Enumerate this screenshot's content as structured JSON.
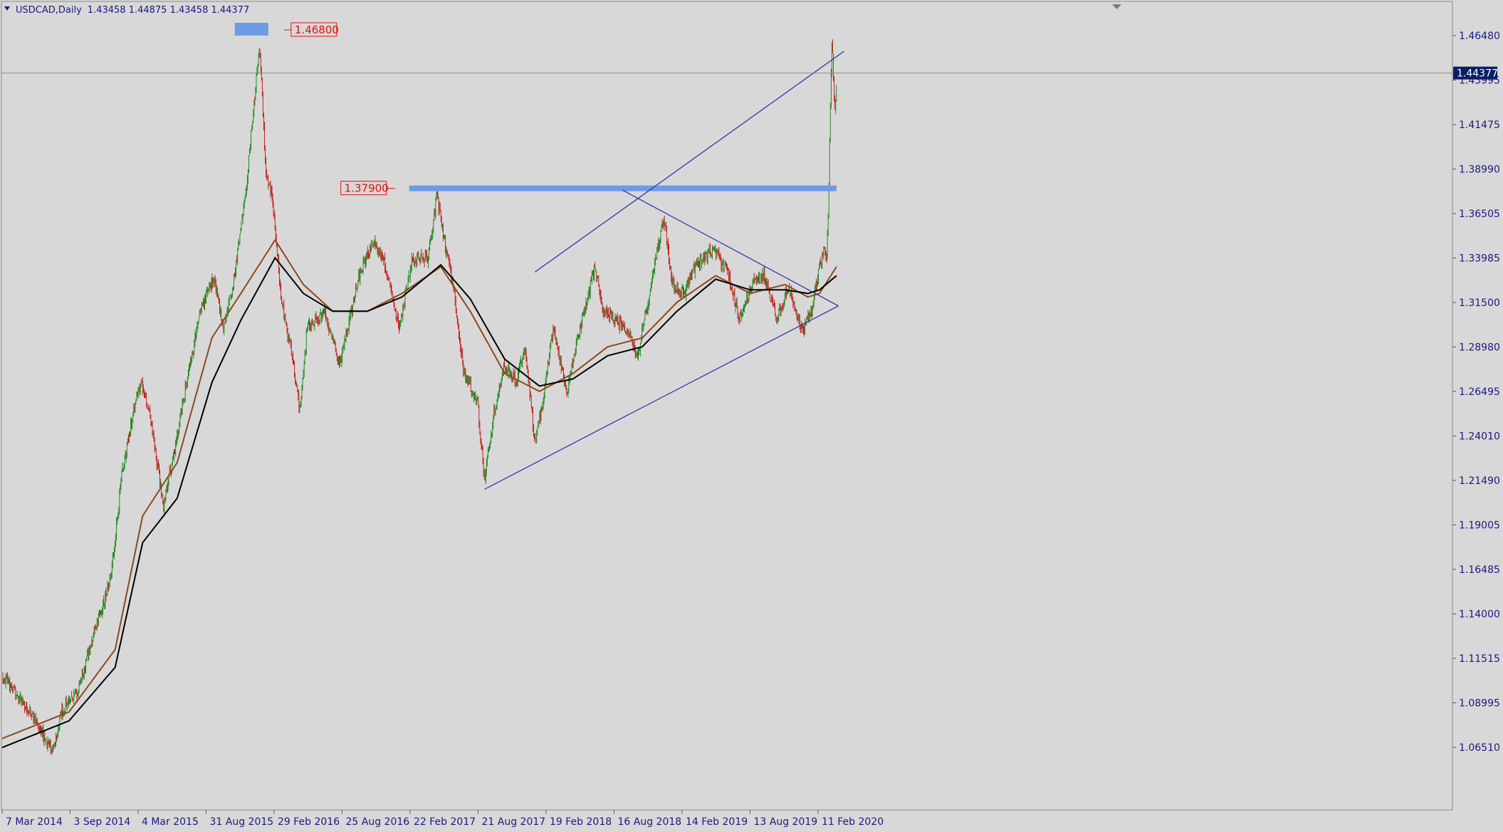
{
  "header": {
    "symbol": "USDCAD,Daily",
    "ohlc": "1.43458 1.44875 1.43458 1.44377"
  },
  "price_label": "1.44377",
  "annotations": {
    "high_label": "1.46800",
    "resistance_label": "1.37900"
  },
  "colors": {
    "background": "#d8d8d8",
    "axis_text": "#1a1a80",
    "bull": "#1f8a1f",
    "bear": "#c81e1e",
    "ma_fast": "#8b4a1c",
    "ma_slow": "#000000",
    "zone": "#6e9be6",
    "trendline": "#2a2aa8",
    "current_price_bg": "#0a1e66",
    "annotation_red": "#e01010"
  },
  "chart_data": {
    "type": "candlestick",
    "symbol": "USDCAD",
    "timeframe": "Daily",
    "ylim": [
      1.055,
      1.475
    ],
    "y_ticks": [
      "1.46480",
      "1.43995",
      "1.41475",
      "1.38990",
      "1.36505",
      "1.33985",
      "1.31500",
      "1.28980",
      "1.26495",
      "1.24010",
      "1.21490",
      "1.19005",
      "1.16485",
      "1.14000",
      "1.11515",
      "1.08995",
      "1.06510"
    ],
    "x_ticks": [
      "7 Mar 2014",
      "3 Sep 2014",
      "4 Mar 2015",
      "31 Aug 2015",
      "29 Feb 2016",
      "25 Aug 2016",
      "22 Feb 2017",
      "21 Aug 2017",
      "19 Feb 2018",
      "16 Aug 2018",
      "14 Feb 2019",
      "13 Aug 2019",
      "11 Feb 2020"
    ],
    "price_path": [
      [
        "2014-03-07",
        1.105
      ],
      [
        "2014-04-15",
        1.095
      ],
      [
        "2014-06-01",
        1.08
      ],
      [
        "2014-07-01",
        1.07
      ],
      [
        "2014-07-20",
        1.062
      ],
      [
        "2014-08-10",
        1.085
      ],
      [
        "2014-09-20",
        1.095
      ],
      [
        "2014-11-01",
        1.125
      ],
      [
        "2014-12-20",
        1.16
      ],
      [
        "2015-01-20",
        1.22
      ],
      [
        "2015-02-15",
        1.25
      ],
      [
        "2015-03-10",
        1.27
      ],
      [
        "2015-04-05",
        1.25
      ],
      [
        "2015-05-10",
        1.2
      ],
      [
        "2015-06-10",
        1.235
      ],
      [
        "2015-07-10",
        1.27
      ],
      [
        "2015-08-15",
        1.31
      ],
      [
        "2015-09-20",
        1.33
      ],
      [
        "2015-10-15",
        1.3
      ],
      [
        "2015-11-15",
        1.33
      ],
      [
        "2015-12-20",
        1.39
      ],
      [
        "2016-01-20",
        1.46
      ],
      [
        "2016-02-05",
        1.39
      ],
      [
        "2016-02-25",
        1.37
      ],
      [
        "2016-03-15",
        1.32
      ],
      [
        "2016-04-10",
        1.29
      ],
      [
        "2016-05-05",
        1.255
      ],
      [
        "2016-05-25",
        1.3
      ],
      [
        "2016-07-10",
        1.31
      ],
      [
        "2016-08-20",
        1.28
      ],
      [
        "2016-10-10",
        1.33
      ],
      [
        "2016-11-15",
        1.35
      ],
      [
        "2016-12-20",
        1.335
      ],
      [
        "2017-01-25",
        1.3
      ],
      [
        "2017-03-01",
        1.34
      ],
      [
        "2017-04-10",
        1.34
      ],
      [
        "2017-05-05",
        1.375
      ],
      [
        "2017-05-20",
        1.355
      ],
      [
        "2017-06-20",
        1.32
      ],
      [
        "2017-07-15",
        1.275
      ],
      [
        "2017-08-20",
        1.26
      ],
      [
        "2017-09-08",
        1.215
      ],
      [
        "2017-10-05",
        1.255
      ],
      [
        "2017-11-01",
        1.28
      ],
      [
        "2017-12-01",
        1.27
      ],
      [
        "2017-12-25",
        1.29
      ],
      [
        "2018-01-20",
        1.235
      ],
      [
        "2018-02-10",
        1.26
      ],
      [
        "2018-03-10",
        1.3
      ],
      [
        "2018-04-15",
        1.265
      ],
      [
        "2018-05-20",
        1.3
      ],
      [
        "2018-06-28",
        1.335
      ],
      [
        "2018-07-20",
        1.31
      ],
      [
        "2018-08-20",
        1.305
      ],
      [
        "2018-09-20",
        1.3
      ],
      [
        "2018-10-20",
        1.285
      ],
      [
        "2018-11-20",
        1.32
      ],
      [
        "2018-12-28",
        1.363
      ],
      [
        "2019-01-20",
        1.325
      ],
      [
        "2019-02-20",
        1.32
      ],
      [
        "2019-03-20",
        1.335
      ],
      [
        "2019-05-10",
        1.345
      ],
      [
        "2019-06-20",
        1.33
      ],
      [
        "2019-07-15",
        1.305
      ],
      [
        "2019-08-20",
        1.325
      ],
      [
        "2019-09-20",
        1.33
      ],
      [
        "2019-10-25",
        1.305
      ],
      [
        "2019-11-25",
        1.325
      ],
      [
        "2019-12-31",
        1.298
      ],
      [
        "2020-01-25",
        1.31
      ],
      [
        "2020-02-10",
        1.33
      ],
      [
        "2020-02-28",
        1.345
      ],
      [
        "2020-03-05",
        1.34
      ],
      [
        "2020-03-10",
        1.375
      ],
      [
        "2020-03-19",
        1.465
      ],
      [
        "2020-03-26",
        1.42
      ],
      [
        "2020-03-31",
        1.44
      ]
    ],
    "moving_averages": [
      {
        "color_key": "ma_fast",
        "path": [
          [
            "2014-03-07",
            1.07
          ],
          [
            "2014-09-01",
            1.085
          ],
          [
            "2015-01-01",
            1.12
          ],
          [
            "2015-03-15",
            1.195
          ],
          [
            "2015-06-15",
            1.225
          ],
          [
            "2015-09-15",
            1.295
          ],
          [
            "2015-12-01",
            1.32
          ],
          [
            "2016-03-01",
            1.35
          ],
          [
            "2016-05-15",
            1.325
          ],
          [
            "2016-08-01",
            1.31
          ],
          [
            "2016-11-01",
            1.31
          ],
          [
            "2017-02-01",
            1.32
          ],
          [
            "2017-05-15",
            1.335
          ],
          [
            "2017-08-01",
            1.31
          ],
          [
            "2017-11-01",
            1.275
          ],
          [
            "2018-02-01",
            1.265
          ],
          [
            "2018-05-01",
            1.275
          ],
          [
            "2018-08-01",
            1.29
          ],
          [
            "2018-11-01",
            1.295
          ],
          [
            "2019-02-01",
            1.315
          ],
          [
            "2019-05-15",
            1.33
          ],
          [
            "2019-08-15",
            1.32
          ],
          [
            "2019-11-15",
            1.325
          ],
          [
            "2020-01-15",
            1.318
          ],
          [
            "2020-02-15",
            1.32
          ],
          [
            "2020-03-31",
            1.335
          ]
        ]
      },
      {
        "color_key": "ma_slow",
        "path": [
          [
            "2014-03-07",
            1.065
          ],
          [
            "2014-09-01",
            1.08
          ],
          [
            "2015-01-01",
            1.11
          ],
          [
            "2015-03-15",
            1.18
          ],
          [
            "2015-06-15",
            1.205
          ],
          [
            "2015-09-15",
            1.27
          ],
          [
            "2015-12-01",
            1.305
          ],
          [
            "2016-03-01",
            1.34
          ],
          [
            "2016-05-15",
            1.32
          ],
          [
            "2016-08-01",
            1.31
          ],
          [
            "2016-11-01",
            1.31
          ],
          [
            "2017-02-01",
            1.318
          ],
          [
            "2017-05-15",
            1.336
          ],
          [
            "2017-08-01",
            1.317
          ],
          [
            "2017-11-01",
            1.283
          ],
          [
            "2018-02-01",
            1.268
          ],
          [
            "2018-05-01",
            1.272
          ],
          [
            "2018-08-01",
            1.285
          ],
          [
            "2018-11-01",
            1.29
          ],
          [
            "2019-02-01",
            1.31
          ],
          [
            "2019-05-15",
            1.328
          ],
          [
            "2019-08-15",
            1.322
          ],
          [
            "2019-11-15",
            1.322
          ],
          [
            "2020-01-15",
            1.32
          ],
          [
            "2020-02-15",
            1.322
          ],
          [
            "2020-03-31",
            1.33
          ]
        ]
      }
    ],
    "current_price": 1.44377,
    "zones": [
      {
        "label_key": "high_label",
        "price": 1.468,
        "from": "2015-11-15",
        "to": "2016-02-12",
        "kind": "marker"
      },
      {
        "label_key": "resistance_label",
        "price": 1.379,
        "from": "2017-02-20",
        "to": "2020-03-31",
        "kind": "band"
      }
    ],
    "trendlines": [
      {
        "from": [
          "2017-09-08",
          1.21
        ],
        "to": [
          "2020-04-05",
          1.313
        ]
      },
      {
        "from": [
          "2018-01-20",
          1.332
        ],
        "to": [
          "2020-04-20",
          1.456
        ]
      },
      {
        "from": [
          "2018-09-10",
          1.378
        ],
        "to": [
          "2020-04-05",
          1.313
        ]
      }
    ]
  }
}
